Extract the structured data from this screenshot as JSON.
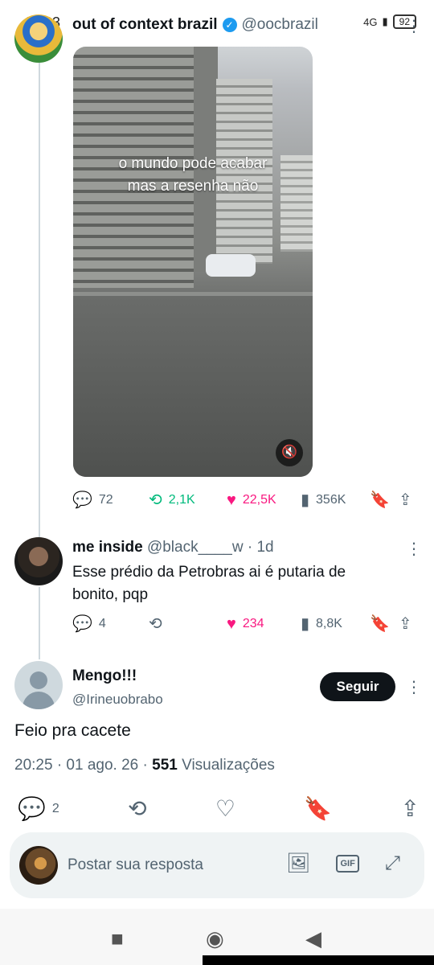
{
  "status": {
    "time": "19:33",
    "network": "4G",
    "battery": "92"
  },
  "tweet": {
    "author_name": "out of context brazil",
    "author_handle": "@oocbrazil",
    "video_caption_line1": "o mundo pode acabar",
    "video_caption_line2": "mas a resenha não",
    "replies": "72",
    "retweets": "2,1K",
    "likes": "22,5K",
    "views": "356K"
  },
  "reply": {
    "name": "me inside",
    "handle": "@black____w",
    "time": "1d",
    "text": "Esse prédio da Petrobras ai é putaria de bonito, pqp",
    "replies": "4",
    "likes": "234",
    "views": "8,8K"
  },
  "main": {
    "name": "Mengo!!!",
    "handle": "@Irineuobrabo",
    "follow_label": "Seguir",
    "text": "Feio pra cacete",
    "timestamp": "20:25 · 01 ago. 26 ·",
    "views_count": "551",
    "views_label": "Visualizações",
    "replies": "2"
  },
  "reply_bar": {
    "placeholder": "Postar sua resposta"
  },
  "colors": {
    "retweet_green": "#00ba7c",
    "like_pink": "#f91880",
    "verified_blue": "#1d9bf0",
    "secondary_text": "#536471"
  }
}
